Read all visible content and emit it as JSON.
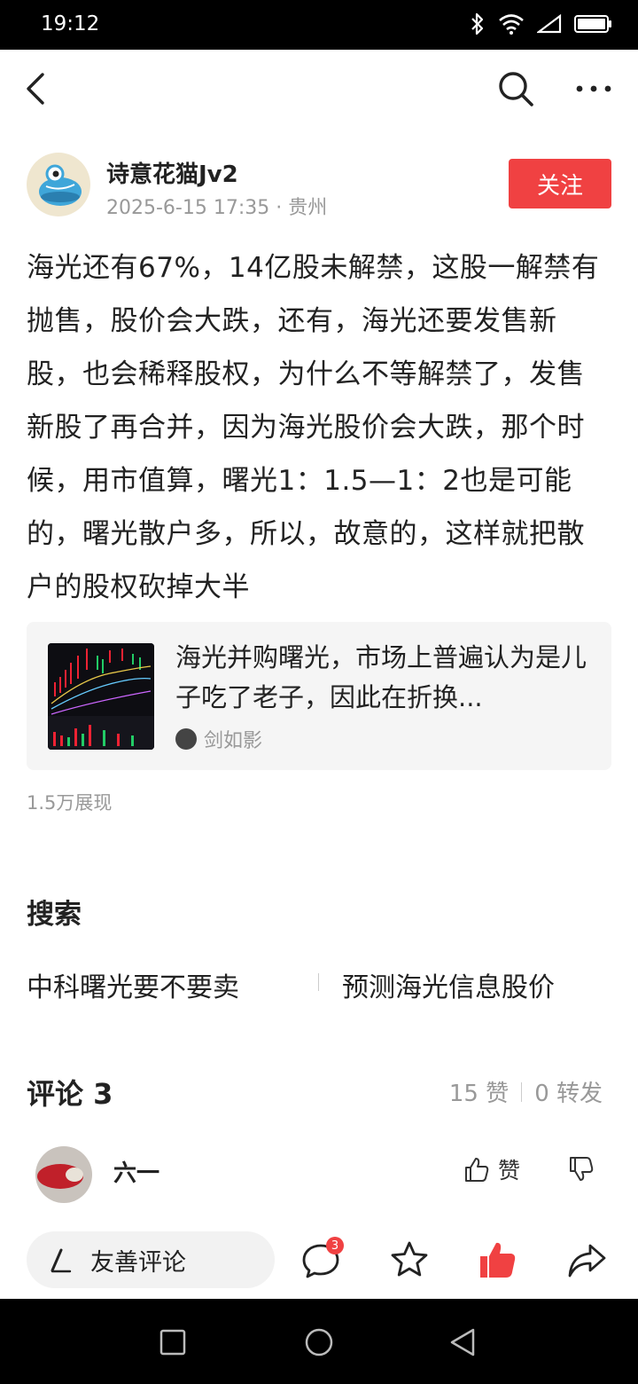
{
  "status_bar": {
    "time": "19:12"
  },
  "author": {
    "name": "诗意花猫Jv2",
    "meta": "2025-6-15 17:35 · 贵州",
    "follow_label": "关注"
  },
  "post": {
    "text": "海光还有67%，14亿股未解禁，这股一解禁有抛售，股价会大跌，还有，海光还要发售新股，也会稀释股权，为什么不等解禁了，发售新股了再合并，因为海光股价会大跌，那个时候，用市值算，曙光1：1.5—1：2也是可能的，曙光散户多，所以，故意的，这样就把散户的股权砍掉大半"
  },
  "ref_card": {
    "title": "海光并购曙光，市场上普遍认为是儿子吃了老子，因此在折换...",
    "author": "剑如影"
  },
  "views": "1.5万展现",
  "search": {
    "title": "搜索",
    "items": [
      "中科曙光要不要卖",
      "预测海光信息股价"
    ]
  },
  "comments": {
    "header": "评论 3",
    "likes": "15 赞",
    "reposts": "0 转发",
    "items": [
      {
        "name": "六一",
        "like_label": "赞"
      }
    ]
  },
  "bottom_bar": {
    "input_placeholder": "友善评论",
    "comment_badge": "3"
  },
  "colors": {
    "accent": "#f04142",
    "text": "#222222",
    "muted": "#999999"
  }
}
